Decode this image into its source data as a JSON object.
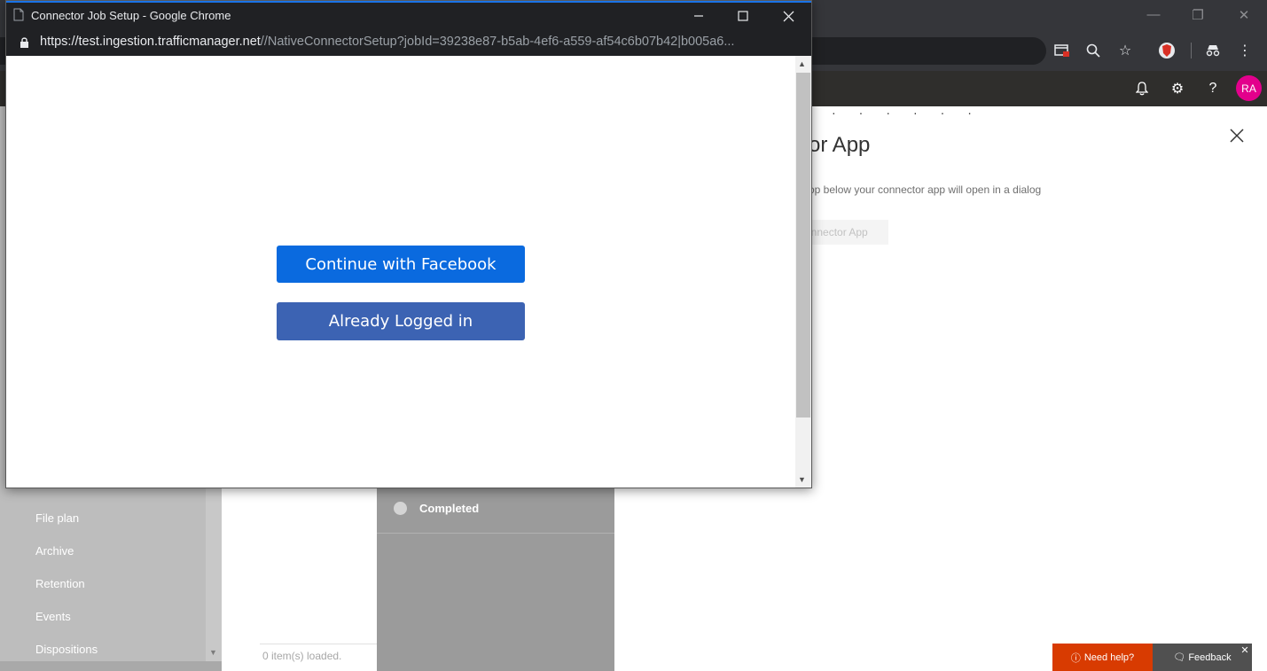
{
  "popup": {
    "window_title": "Connector Job Setup - Google Chrome",
    "url_host": "https://test.ingestion.trafficmanager.net",
    "url_path": "//NativeConnectorSetup?jobId=39238e87-b5ab-4ef6-a559-af54c6b07b42|b005a6...",
    "buttons": {
      "continue_facebook": "Continue with Facebook",
      "already_logged_in": "Already Logged in"
    }
  },
  "app_header": {
    "avatar_initials": "RA"
  },
  "left_nav": {
    "items": [
      {
        "label": "File plan"
      },
      {
        "label": "Archive"
      },
      {
        "label": "Retention"
      },
      {
        "label": "Events"
      },
      {
        "label": "Dispositions"
      }
    ]
  },
  "list": {
    "status": "0 item(s) loaded."
  },
  "steps": {
    "completed_label": "Completed"
  },
  "flyout": {
    "title_fragment": "or App",
    "description_fragment": "op below your connector app will open in a dialog",
    "button_fragment": "onnector App"
  },
  "help": {
    "need_help": "Need help?",
    "feedback": "Feedback"
  },
  "colors": {
    "facebook_button": "#0a6adf",
    "logged_in_button": "#3c63b3",
    "avatar": "#e3008c",
    "need_help_bg": "#d83b01",
    "chrome_dark": "#202124"
  }
}
